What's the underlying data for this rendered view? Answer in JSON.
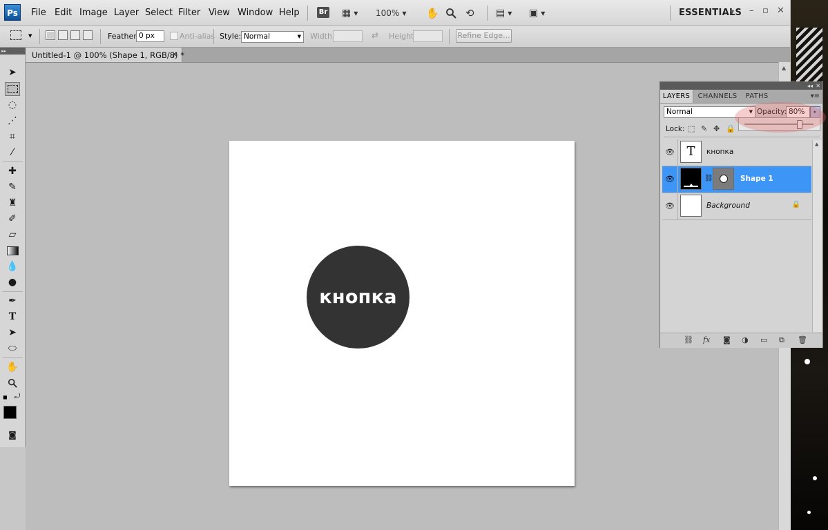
{
  "app": {
    "logo": "Ps"
  },
  "menu": {
    "items": [
      "File",
      "Edit",
      "Image",
      "Layer",
      "Select",
      "Filter",
      "View",
      "Window",
      "Help"
    ],
    "bridge": "Br",
    "zoom": "100%",
    "workspace": "ESSENTIALS"
  },
  "options": {
    "feather_label": "Feather:",
    "feather_value": "0 px",
    "antialias_label": "Anti-alias",
    "style_label": "Style:",
    "style_value": "Normal",
    "width_label": "Width:",
    "height_label": "Height:",
    "refine_edge": "Refine Edge..."
  },
  "document": {
    "tab_title": "Untitled-1 @ 100% (Shape 1, RGB/8) *",
    "button_text": "кнопка",
    "circle_color": "#333333"
  },
  "layers_panel": {
    "tabs": [
      "LAYERS",
      "CHANNELS",
      "PATHS"
    ],
    "blend_mode": "Normal",
    "opacity_label": "Opacity:",
    "opacity_value": "80%",
    "opacity_slider_level": 0.8,
    "lock_label": "Lock:",
    "layers": [
      {
        "name": "кнопка",
        "type": "text",
        "thumb_glyph": "T",
        "visible": true,
        "selected": false
      },
      {
        "name": "Shape 1",
        "type": "shape",
        "visible": true,
        "selected": true
      },
      {
        "name": "Background",
        "type": "background",
        "visible": true,
        "selected": false,
        "locked": true
      }
    ]
  },
  "colors": {
    "selected_layer": "#3d95f6",
    "foreground": "#000000",
    "background": "#ffffff",
    "highlight": "#e46262"
  }
}
